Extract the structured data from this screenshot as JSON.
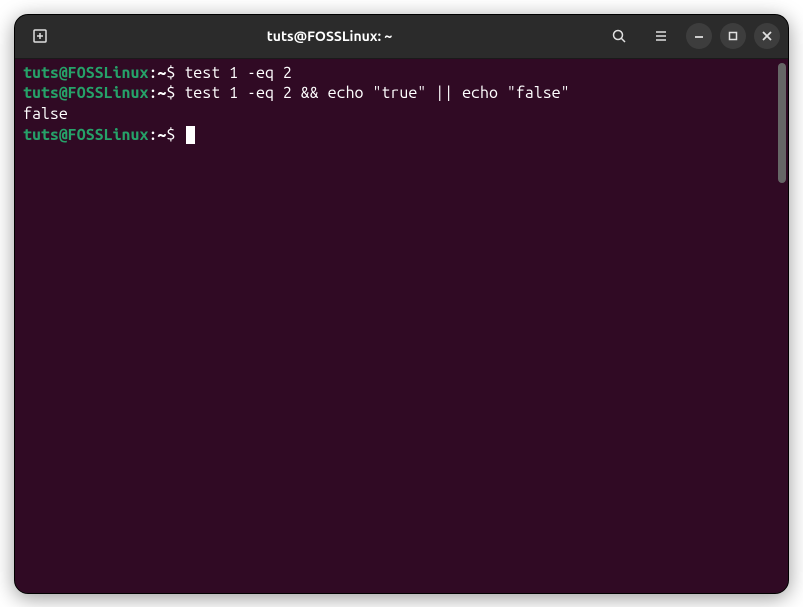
{
  "titlebar": {
    "title": "tuts@FOSSLinux: ~"
  },
  "terminal": {
    "lines": [
      {
        "user": "tuts@FOSSLinux",
        "path": "~",
        "command": "test 1 -eq 2"
      },
      {
        "user": "tuts@FOSSLinux",
        "path": "~",
        "command": "test 1 -eq 2 && echo \"true\" || echo \"false\""
      },
      {
        "output": "false"
      },
      {
        "user": "tuts@FOSSLinux",
        "path": "~",
        "command": ""
      }
    ]
  }
}
